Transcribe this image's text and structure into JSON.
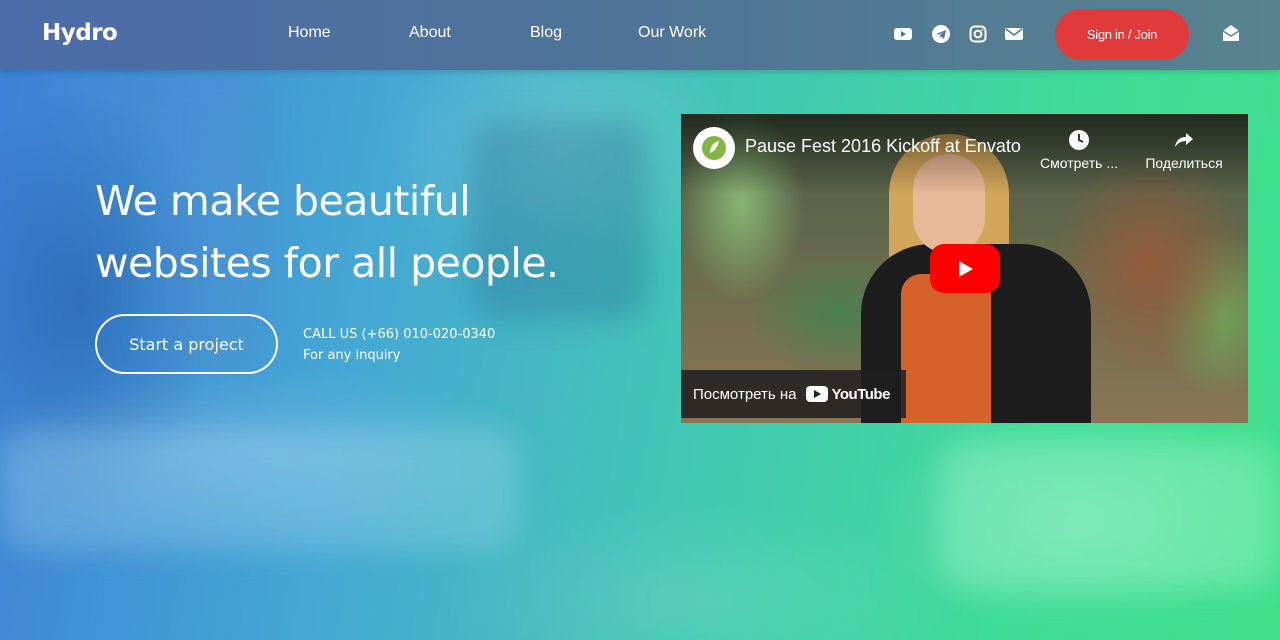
{
  "brand": {
    "logo": "Hydro"
  },
  "nav": {
    "links": [
      "Home",
      "About",
      "Blog",
      "Our Work"
    ],
    "social_icons": [
      "youtube-icon",
      "telegram-icon",
      "instagram-icon",
      "envelope-icon"
    ],
    "signin_label": "Sign in / Join",
    "mail_icon": "open-envelope-icon"
  },
  "hero": {
    "headline_line1": "We make beautiful",
    "headline_line2": "websites for all people.",
    "cta_label": "Start a project",
    "call_line": "CALL US (+66) 010-020-0340",
    "call_sub": "For any inquiry"
  },
  "video": {
    "title": "Pause Fest 2016 Kickoff at Envato",
    "watch_later": "Смотреть ...",
    "share": "Поделиться",
    "watch_on": "Посмотреть на",
    "youtube": "YouTube"
  },
  "colors": {
    "accent_red": "#e03a3a",
    "youtube_red": "#ff0000",
    "gradient_start": "#3d7fd6",
    "gradient_end": "#3fe08a"
  }
}
